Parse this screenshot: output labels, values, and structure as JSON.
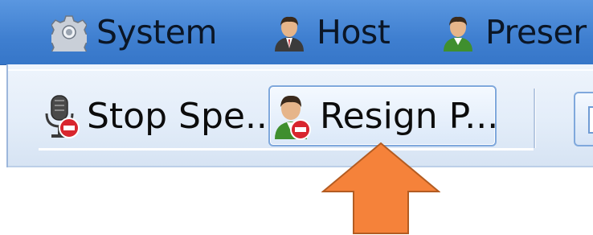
{
  "menubar": {
    "tabs": [
      {
        "label": "System",
        "icon": "gear-icon"
      },
      {
        "label": "Host",
        "icon": "host-user-icon"
      },
      {
        "label": "Preser",
        "icon": "presenter-user-icon"
      }
    ]
  },
  "ribbon": {
    "stop_speaking_label": "Stop Spe...",
    "stop_speaking_icon": "microphone-stop-icon",
    "resign_label": "Resign P...",
    "resign_icon": "user-remove-icon"
  },
  "callout": {
    "arrow_color": "#F5823A",
    "arrow_icon": "up-arrow-icon"
  }
}
